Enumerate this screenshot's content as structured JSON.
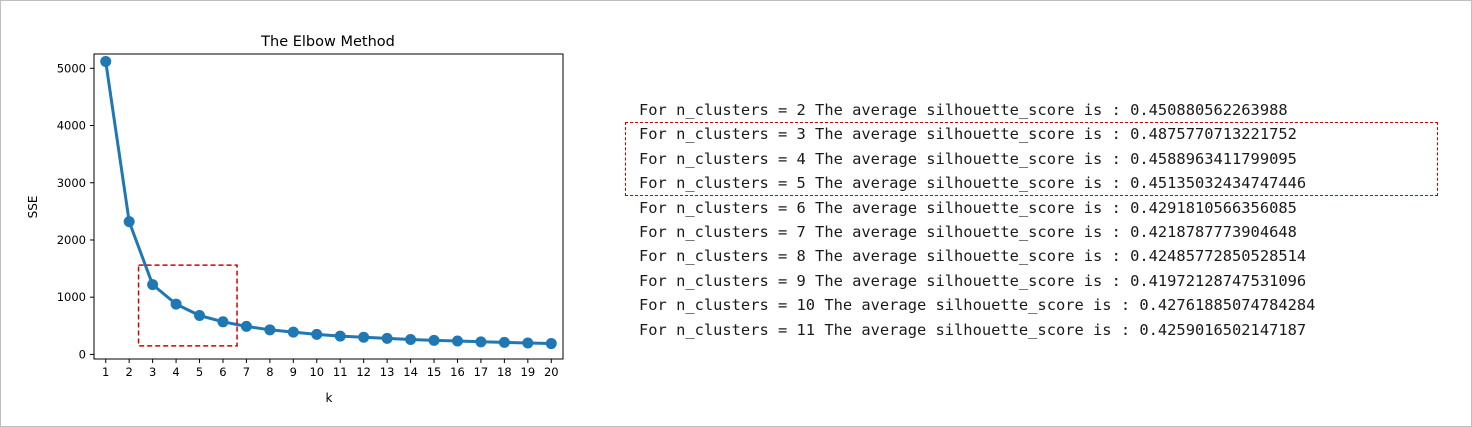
{
  "chart_data": {
    "type": "line",
    "title": "The Elbow Method",
    "xlabel": "k",
    "ylabel": "SSE",
    "xlim": [
      0.5,
      20.5
    ],
    "ylim": [
      -80,
      5250
    ],
    "x": [
      1,
      2,
      3,
      4,
      5,
      6,
      7,
      8,
      9,
      10,
      11,
      12,
      13,
      14,
      15,
      16,
      17,
      18,
      19,
      20
    ],
    "xticks": [
      1,
      2,
      3,
      4,
      5,
      6,
      7,
      8,
      9,
      10,
      11,
      12,
      13,
      14,
      15,
      16,
      17,
      18,
      19,
      20
    ],
    "yticks": [
      0,
      1000,
      2000,
      3000,
      4000,
      5000
    ],
    "series": [
      {
        "values": [
          5120,
          2320,
          1220,
          880,
          680,
          570,
          490,
          430,
          390,
          350,
          320,
          300,
          280,
          260,
          245,
          235,
          220,
          210,
          200,
          190
        ],
        "color": "#1f77b4"
      }
    ],
    "marker": "circle",
    "grid": false,
    "highlight": {
      "k_range": [
        2.4,
        6.6
      ],
      "sse_range": [
        150,
        1560
      ],
      "color": "#d00000"
    }
  },
  "console": {
    "lines": [
      "For n_clusters = 2 The average silhouette_score is : 0.450880562263988",
      "For n_clusters = 3 The average silhouette_score is : 0.4875770713221752",
      "For n_clusters = 4 The average silhouette_score is : 0.4588963411799095",
      "For n_clusters = 5 The average silhouette_score is : 0.45135032434747446",
      "For n_clusters = 6 The average silhouette_score is : 0.4291810566356085",
      "For n_clusters = 7 The average silhouette_score is : 0.4218787773904648",
      "For n_clusters = 8 The average silhouette_score is : 0.42485772850528514",
      "For n_clusters = 9 The average silhouette_score is : 0.41972128747531096",
      "For n_clusters = 10 The average silhouette_score is : 0.42761885074784284",
      "For n_clusters = 11 The average silhouette_score is : 0.4259016502147187"
    ],
    "highlighted_lines": [
      1,
      2,
      3
    ],
    "highlight_color": "#d00000"
  }
}
